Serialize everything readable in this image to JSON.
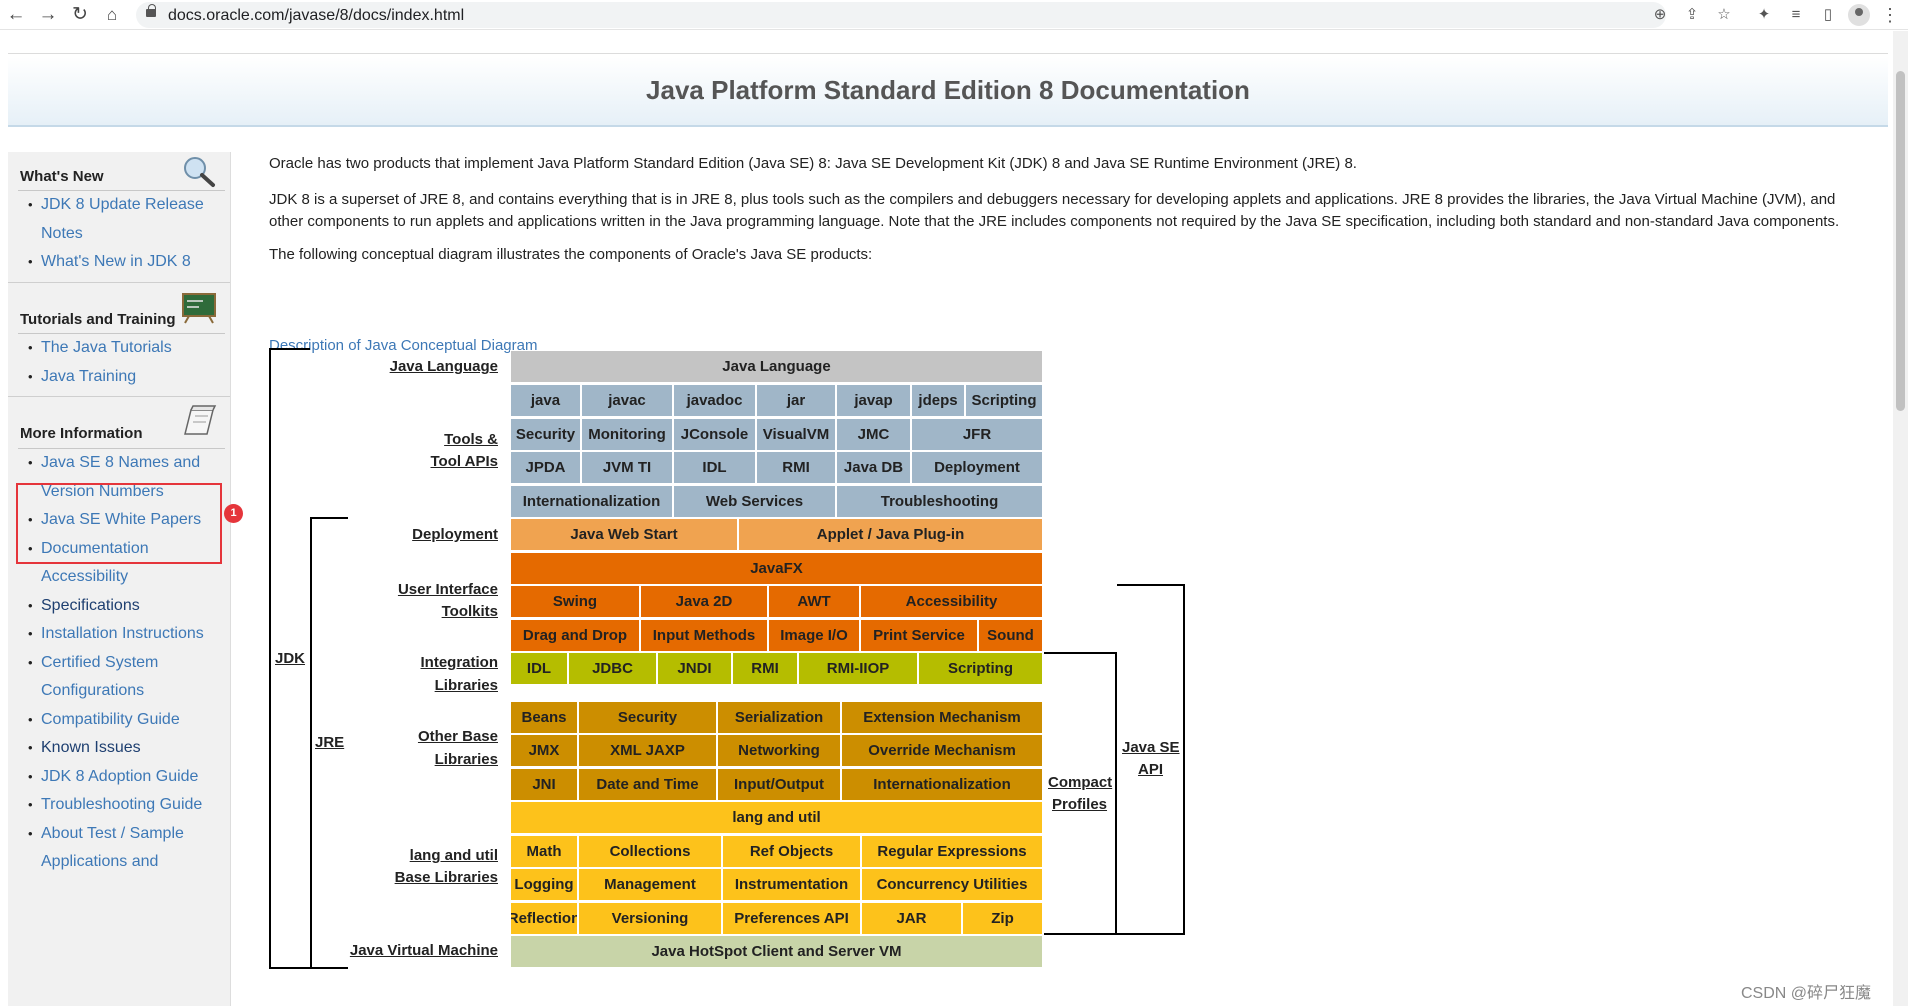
{
  "browser": {
    "url": "docs.oracle.com/javase/8/docs/index.html"
  },
  "page": {
    "title": "Java Platform Standard Edition 8 Documentation"
  },
  "sidebar": {
    "whats_new": {
      "heading": "What's New",
      "icon": "magnifier-icon",
      "items": [
        {
          "label": "JDK 8 Update Release Notes"
        },
        {
          "label": "What's New in JDK 8"
        }
      ]
    },
    "tutorials": {
      "heading": "Tutorials and Training",
      "icon": "chalkboard-icon",
      "items": [
        {
          "label": "The Java Tutorials"
        },
        {
          "label": "Java Training"
        }
      ]
    },
    "more_info": {
      "heading": "More Information",
      "icon": "book-icon",
      "items": [
        {
          "label": "Java SE 8 Names and Version Numbers"
        },
        {
          "label": "Java SE White Papers"
        },
        {
          "label": "Documentation Accessibility"
        },
        {
          "label": "Specifications"
        },
        {
          "label": "Installation Instructions"
        },
        {
          "label": "Certified System Configurations"
        },
        {
          "label": "Compatibility Guide"
        },
        {
          "label": "Known Issues"
        },
        {
          "label": "JDK 8 Adoption Guide"
        },
        {
          "label": "Troubleshooting Guide"
        },
        {
          "label": "About Test / Sample Applications and"
        }
      ]
    },
    "annotation_badge": "1"
  },
  "content": {
    "p1": "Oracle has two products that implement Java Platform Standard Edition (Java SE) 8: Java SE Development Kit (JDK) 8 and Java SE Runtime Environment (JRE) 8.",
    "p2_line1": "JDK 8 is a superset of JRE 8, and contains everything that is in JRE 8, plus tools such as the compilers and debuggers necessary for developing applets and applications. JRE 8 provides the libraries, the Java Virtual Machine (JVM), and",
    "p2_line2": "other components to run applets and applications written in the Java programming language. Note that the JRE includes components not required by the Java SE specification, including both standard and non-standard Java components.",
    "p3": "The following conceptual diagram illustrates the components of Oracle's Java SE products:",
    "diagram_link": "Description of Java Conceptual Diagram"
  },
  "diagram": {
    "labels": {
      "java_language": "Java Language",
      "tools_1": "Tools &",
      "tools_2": "Tool APIs",
      "deployment": "Deployment",
      "ui_1": "User Interface",
      "ui_2": "Toolkits",
      "integration_1": "Integration",
      "integration_2": "Libraries",
      "other_1": "Other Base",
      "other_2": "Libraries",
      "lang_1": "lang and util",
      "lang_2": "Base Libraries",
      "jvm": "Java Virtual Machine",
      "jdk": "JDK",
      "jre": "JRE",
      "compact_1": "Compact",
      "compact_2": "Profiles",
      "api_1": "Java SE",
      "api_2": "API"
    },
    "rows": {
      "lang": [
        "Java Language"
      ],
      "tools1": [
        "java",
        "javac",
        "javadoc",
        "jar",
        "javap",
        "jdeps",
        "Scripting"
      ],
      "tools2": [
        "Security",
        "Monitoring",
        "JConsole",
        "VisualVM",
        "JMC",
        "JFR"
      ],
      "tools3": [
        "JPDA",
        "JVM TI",
        "IDL",
        "RMI",
        "Java DB",
        "Deployment"
      ],
      "tools4": [
        "Internationalization",
        "Web Services",
        "Troubleshooting"
      ],
      "deploy": [
        "Java Web Start",
        "Applet / Java Plug-in"
      ],
      "javafx": [
        "JavaFX"
      ],
      "ui1": [
        "Swing",
        "Java 2D",
        "AWT",
        "Accessibility"
      ],
      "ui2": [
        "Drag and Drop",
        "Input Methods",
        "Image I/O",
        "Print Service",
        "Sound"
      ],
      "integ": [
        "IDL",
        "JDBC",
        "JNDI",
        "RMI",
        "RMI-IIOP",
        "Scripting"
      ],
      "other1": [
        "Beans",
        "Security",
        "Serialization",
        "Extension Mechanism"
      ],
      "other2": [
        "JMX",
        "XML JAXP",
        "Networking",
        "Override Mechanism"
      ],
      "other3": [
        "JNI",
        "Date and Time",
        "Input/Output",
        "Internationalization"
      ],
      "langutil": [
        "lang and util"
      ],
      "lang1": [
        "Math",
        "Collections",
        "Ref Objects",
        "Regular Expressions"
      ],
      "lang2": [
        "Logging",
        "Management",
        "Instrumentation",
        "Concurrency Utilities"
      ],
      "lang3": [
        "Reflection",
        "Versioning",
        "Preferences API",
        "JAR",
        "Zip"
      ],
      "vm": [
        "Java HotSpot Client and Server VM"
      ]
    }
  },
  "watermark": "CSDN @碎尸狂魔"
}
